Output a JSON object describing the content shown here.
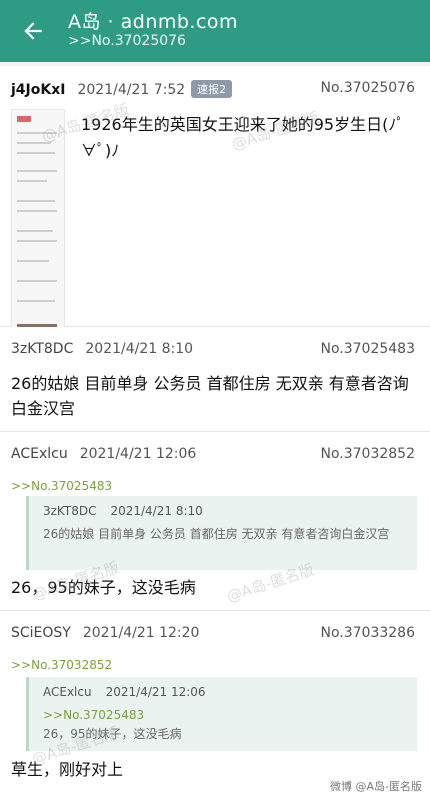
{
  "header": {
    "title": "A岛 · adnmb.com",
    "subtitle": ">>No.37025076"
  },
  "posts": [
    {
      "uid": "j4JoKxI",
      "time": "2021/4/21 7:52",
      "badge": "速报2",
      "no": "No.37025076",
      "content": "1926年生的英国女王迎来了她的95岁生日(ﾉﾟ∀ﾟ)ﾉ"
    },
    {
      "uid": "3zKT8DC",
      "time": "2021/4/21 8:10",
      "no": "No.37025483",
      "content": "26的姑娘 目前单身 公务员 首都住房 无双亲 有意者咨询白金汉宫"
    },
    {
      "uid": "ACExlcu",
      "time": "2021/4/21 12:06",
      "no": "No.37032852",
      "reflink": ">>No.37025483",
      "quote": {
        "uid": "3zKT8DC",
        "time": "2021/4/21 8:10",
        "body": "26的姑娘 目前单身 公务员 首都住房 无双亲 有意者咨询白金汉宫"
      },
      "content": "26，95的妹子，这没毛病"
    },
    {
      "uid": "SCiEOSY",
      "time": "2021/4/21 12:20",
      "no": "No.37033286",
      "reflink": ">>No.37032852",
      "quote": {
        "uid": "ACExlcu",
        "time": "2021/4/21 12:06",
        "ref": ">>No.37025483",
        "body": "26，95的妹子，这没毛病"
      },
      "content": "草生，刚好对上"
    }
  ],
  "watermarks": {
    "main": "@A岛-匿名版",
    "footer": "微博 @A岛-匿名版"
  },
  "colors": {
    "appbar": "#2e9c84",
    "reflink": "#7aa23a",
    "quote_bg": "#eaf3ef"
  }
}
